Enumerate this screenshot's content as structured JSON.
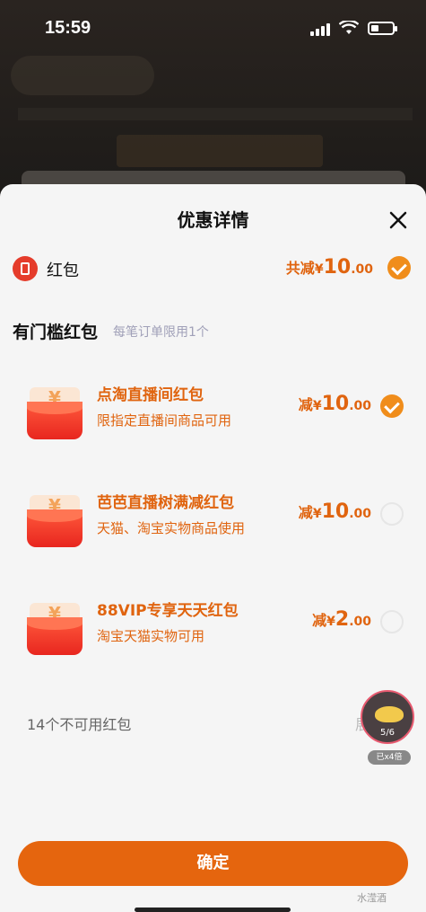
{
  "status_bar": {
    "time": "15:59"
  },
  "sheet": {
    "title": "优惠详情",
    "red_packet": {
      "label": "红包",
      "total_prefix": "共减",
      "currency": "¥",
      "total_int": "10",
      "total_dec": ".00",
      "selected": true
    },
    "section": {
      "title": "有门槛红包",
      "note": "每笔订单限用1个"
    },
    "coupons": [
      {
        "title": "点淘直播间红包",
        "desc": "限指定直播间商品可用",
        "prefix": "减",
        "currency": "¥",
        "int": "10",
        "dec": ".00",
        "selected": true
      },
      {
        "title": "芭芭直播树满减红包",
        "desc": "天猫、淘宝实物商品使用",
        "prefix": "减",
        "currency": "¥",
        "int": "10",
        "dec": ".00",
        "selected": false
      },
      {
        "title": "88VIP专享天天红包",
        "desc": "淘宝天猫实物可用",
        "prefix": "减",
        "currency": "¥",
        "int": "2",
        "dec": ".00",
        "selected": false
      }
    ],
    "unavailable_label": "14个不可用红包",
    "expand_label": "展开",
    "floating_badge": {
      "counter": "5/6",
      "label": "已x4倍"
    },
    "confirm_label": "确定",
    "watermark": "水滢酒"
  },
  "colors": {
    "accent": "#e5650e",
    "check": "#f08d1b",
    "red": "#e53c2b"
  }
}
